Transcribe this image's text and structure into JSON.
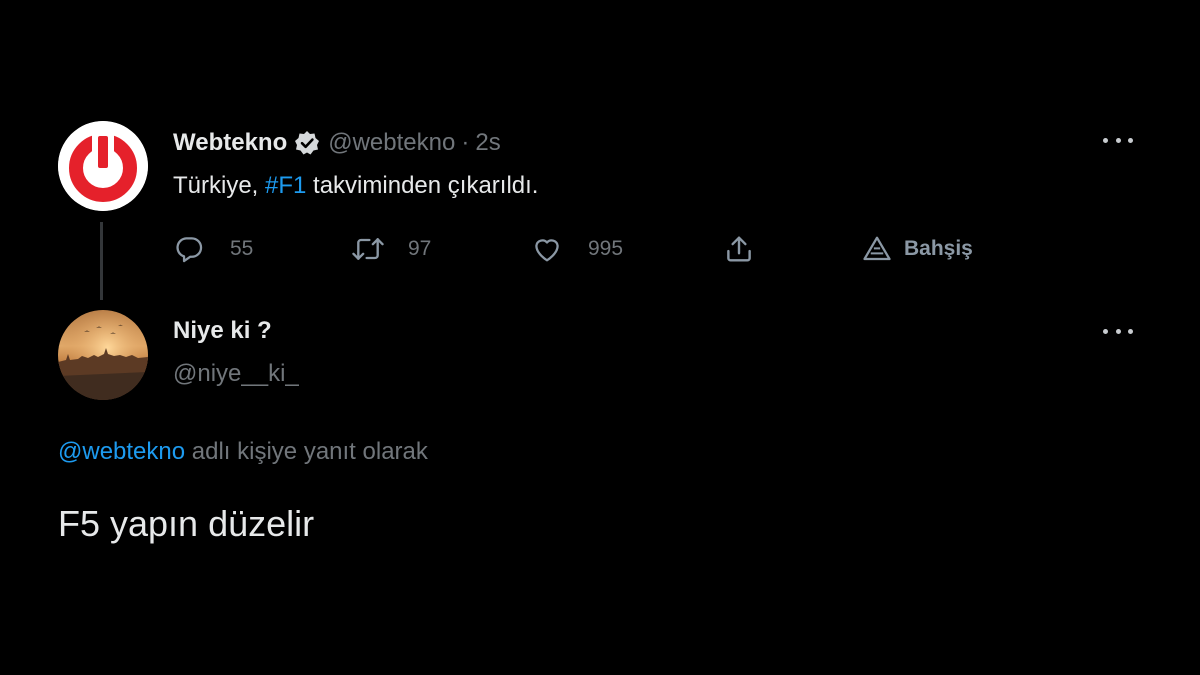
{
  "colors": {
    "background": "#000000",
    "primary_text": "#e7e9ea",
    "secondary_text": "#71767b",
    "accent": "#1d9bf0",
    "brand_red": "#e5212b"
  },
  "original_tweet": {
    "author_name": "Webtekno",
    "verified_icon": "verified-badge-icon",
    "handle": "@webtekno",
    "separator": "·",
    "time": "2s",
    "text_before": "Türkiye, ",
    "hashtag": "#F1",
    "text_after": " takviminden çıkarıldı.",
    "actions": {
      "reply_count": "55",
      "retweet_count": "97",
      "like_count": "995",
      "tip_label": "Bahşiş"
    }
  },
  "reply": {
    "author_name": "Niye ki ?",
    "handle": "@niye__ki_",
    "replying_mention": "@webtekno",
    "replying_suffix": " adlı kişiye yanıt olarak",
    "text": "F5 yapın düzelir"
  }
}
